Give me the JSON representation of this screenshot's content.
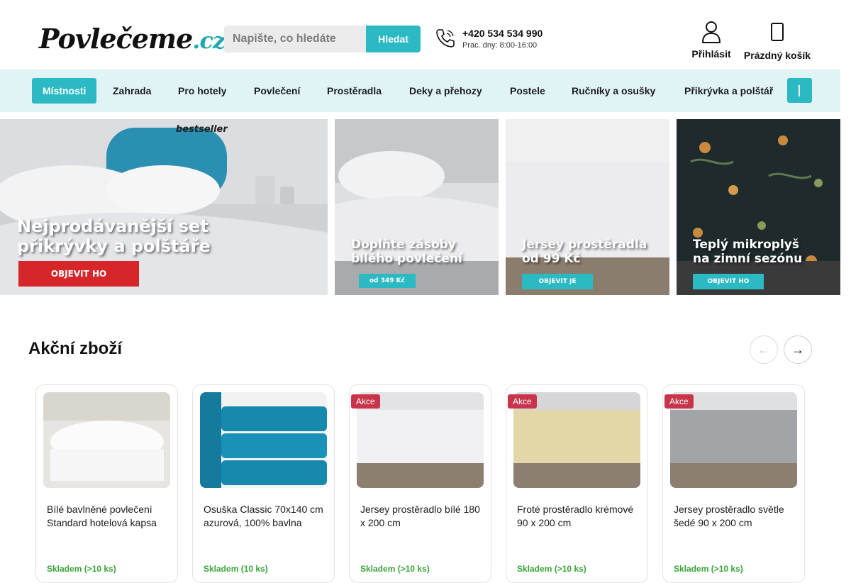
{
  "header": {
    "logo_main": "Povlečeme",
    "logo_tld": ".cz",
    "search_placeholder": "Napište, co hledáte",
    "search_button": "Hledat",
    "phone_number": "+420 534 534 990",
    "phone_hours": "Prac. dny: 8:00-16:00",
    "login_label": "Přihlásit",
    "cart_label": "Prázdný košík",
    "icons": {
      "phone": "phone-icon",
      "login": "user-icon",
      "cart": "cart-icon"
    }
  },
  "nav": {
    "items": [
      {
        "label": "Místnosti",
        "active": true
      },
      {
        "label": "Zahrada"
      },
      {
        "label": "Pro hotely"
      },
      {
        "label": "Povlečení"
      },
      {
        "label": "Prostěradla"
      },
      {
        "label": "Deky a přehozy"
      },
      {
        "label": "Postele"
      },
      {
        "label": "Ručníky a osušky"
      },
      {
        "label": "Přikrývka a polštář"
      }
    ],
    "more_icon": "more-icon"
  },
  "banners": [
    {
      "tag": "bestseller",
      "title_line1": "Nejprodávanější set",
      "title_line2": "přikrývky a polštáře",
      "button": "OBJEVIT HO"
    },
    {
      "title_line1": "Doplňte zásoby",
      "title_line2": "bílého povlečení",
      "price": "od 349 Kč"
    },
    {
      "title_line1": "Jersey prostěradla",
      "title_line2": "od 99 Kč",
      "button": "OBJEVIT JE"
    },
    {
      "title_line1": "Teplý mikroplyš",
      "title_line2": "na zimní sezónu",
      "button": "OBJEVIT HO"
    }
  ],
  "section": {
    "title": "Akční zboží",
    "prev_icon": "←",
    "next_icon": "→"
  },
  "products": [
    {
      "name": "Bílé bavlněné povlečení Standard hotelová kapsa",
      "badge": "",
      "stock": "Skladem (>10 ks)"
    },
    {
      "name": "Osuška Classic 70x140 cm azurová, 100% bavlna",
      "badge": "",
      "stock": "Skladem (10 ks)"
    },
    {
      "name": "Jersey prostěradlo bílé 180 x 200 cm",
      "badge": "Akce",
      "stock": "Skladem (>10 ks)"
    },
    {
      "name": "Froté prostěradlo krémové 90 x 200 cm",
      "badge": "Akce",
      "stock": "Skladem (>10 ks)"
    },
    {
      "name": "Jersey prostěradlo světle šedé 90 x 200 cm",
      "badge": "Akce",
      "stock": "Skladem (>10 ks)"
    }
  ],
  "colors": {
    "accent": "#2bbac3",
    "nav_bg": "#e1f4f5",
    "badge": "#c8344a",
    "button_red": "#d7262a"
  }
}
